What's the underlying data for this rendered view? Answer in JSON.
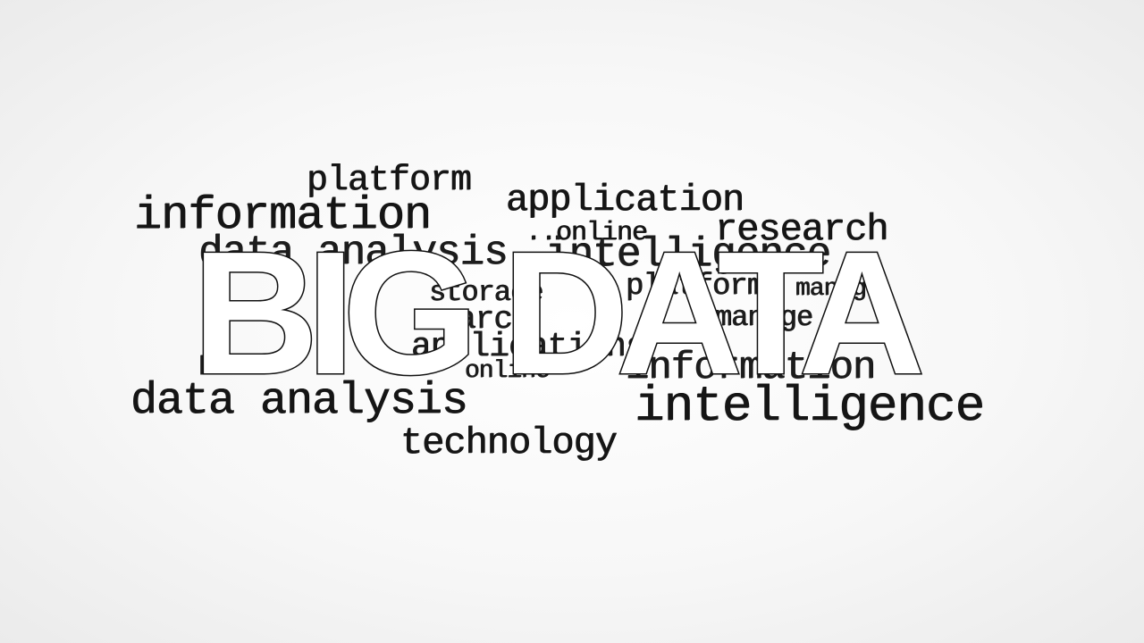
{
  "headline": "BIG DATA",
  "words": {
    "platform": "platform",
    "application": "application",
    "information": "information",
    "online": "..online",
    "research": "research",
    "data_analysis_hidden": "data analysis",
    "intelligence_hidden": "intelligence",
    "fragment_storage": "storage",
    "fragment_search": "search",
    "fragment_applications": "applications",
    "fragment_online": "online",
    "fragment_data": "DATA",
    "fragment_information": "information",
    "fragment_manage": "manage",
    "fragment_platform": "platform",
    "data_analysis": "data analysis",
    "intelligence": "intelligence",
    "technology": "technology"
  }
}
